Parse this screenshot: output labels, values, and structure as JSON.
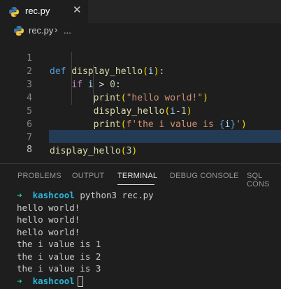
{
  "tab": {
    "filename": "rec.py",
    "close_glyph": "✕"
  },
  "breadcrumb": {
    "file": "rec.py",
    "separator": "›",
    "ellipsis": "..."
  },
  "editor": {
    "line_numbers": [
      "1",
      "2",
      "3",
      "4",
      "5",
      "6",
      "7",
      "8"
    ],
    "active_line": "8",
    "lines": {
      "l1_def": "def",
      "l1_name": "display_hello",
      "l1_open": "(",
      "l1_param": "i",
      "l1_close": ")",
      "l1_colon": ":",
      "l2_if": "if",
      "l2_var": "i",
      "l2_op": " > ",
      "l2_num": "0",
      "l2_colon": ":",
      "l3_fn": "print",
      "l3_open": "(",
      "l3_str": "\"hello world!\"",
      "l3_close": ")",
      "l4_fn": "display_hello",
      "l4_open": "(",
      "l4_var": "i",
      "l4_op": "-",
      "l4_num": "1",
      "l4_close": ")",
      "l5_fn": "print",
      "l5_open": "(",
      "l5_str1": "f'the i value is ",
      "l5_lb": "{",
      "l5_var": "i",
      "l5_rb": "}",
      "l5_str2": "'",
      "l5_close": ")",
      "l7_fn": "display_hello",
      "l7_open": "(",
      "l7_num": "3",
      "l7_close": ")"
    }
  },
  "panel": {
    "tabs": [
      "PROBLEMS",
      "OUTPUT",
      "TERMINAL",
      "DEBUG CONSOLE",
      "SQL CONS"
    ],
    "active_tab": "TERMINAL"
  },
  "terminal": {
    "prompt_arrow": "➜",
    "prompt_host": "kashcool",
    "command": "python3 rec.py",
    "output": [
      "hello world!",
      "hello world!",
      "hello world!",
      "the i value is 1",
      "the i value is 2",
      "the i value is 3"
    ]
  },
  "colors": {
    "keyword": "#569cd6",
    "control": "#c586c0",
    "function": "#dcdcaa",
    "variable": "#9cdcfe",
    "string": "#ce9178",
    "number": "#b5cea8",
    "prompt_green": "#23d18b",
    "prompt_cyan": "#29b8db"
  }
}
